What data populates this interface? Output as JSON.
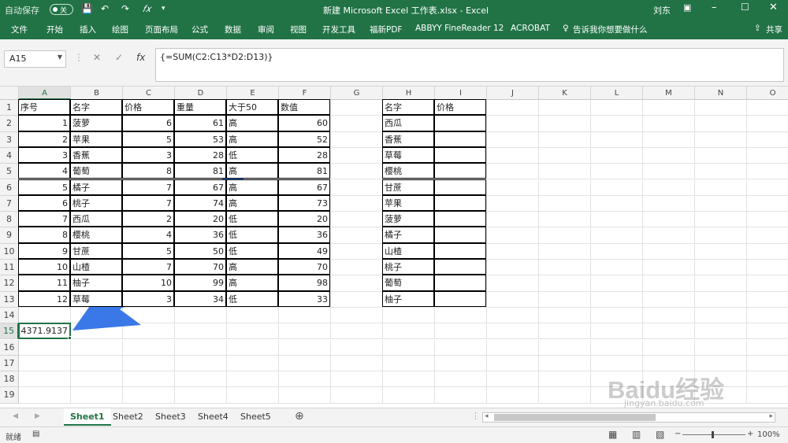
{
  "titlebar": {
    "autosave_label": "自动保存",
    "autosave_state": "关",
    "title": "新建 Microsoft Excel 工作表.xlsx  -  Excel",
    "user": "刘东"
  },
  "ribbon": {
    "tabs": [
      "文件",
      "开始",
      "插入",
      "绘图",
      "页面布局",
      "公式",
      "数据",
      "审阅",
      "视图",
      "开发工具",
      "福新PDF",
      "ABBYY FineReader 12",
      "ACROBAT"
    ],
    "tell_me": "告诉我你想要做什么",
    "share": "共享"
  },
  "formula_bar": {
    "name_box": "A15",
    "formula": "{=SUM(C2:C13*D2:D13)}"
  },
  "columns": [
    "A",
    "B",
    "C",
    "D",
    "E",
    "F",
    "G",
    "H",
    "I",
    "J",
    "K",
    "L",
    "M",
    "N",
    "O"
  ],
  "rows": [
    "1",
    "2",
    "3",
    "4",
    "5",
    "6",
    "7",
    "8",
    "9",
    "10",
    "11",
    "12",
    "13",
    "14",
    "15",
    "16",
    "17",
    "18",
    "19"
  ],
  "table1": {
    "headers": [
      "序号",
      "名字",
      "价格",
      "重量",
      "大于50",
      "数值"
    ],
    "rows": [
      [
        "1",
        "菠萝",
        "6",
        "61",
        "高",
        "60"
      ],
      [
        "2",
        "苹果",
        "5",
        "53",
        "高",
        "52"
      ],
      [
        "3",
        "香蕉",
        "3",
        "28",
        "低",
        "28"
      ],
      [
        "4",
        "葡萄",
        "8",
        "81",
        "高",
        "81"
      ],
      [
        "5",
        "橘子",
        "7",
        "67",
        "高",
        "67"
      ],
      [
        "6",
        "桃子",
        "7",
        "74",
        "高",
        "73"
      ],
      [
        "7",
        "西瓜",
        "2",
        "20",
        "低",
        "20"
      ],
      [
        "8",
        "樱桃",
        "4",
        "36",
        "低",
        "36"
      ],
      [
        "9",
        "甘蔗",
        "5",
        "50",
        "低",
        "49"
      ],
      [
        "10",
        "山楂",
        "7",
        "70",
        "高",
        "70"
      ],
      [
        "11",
        "柚子",
        "10",
        "99",
        "高",
        "98"
      ],
      [
        "12",
        "草莓",
        "3",
        "34",
        "低",
        "33"
      ]
    ]
  },
  "table2": {
    "headers": [
      "名字",
      "价格"
    ],
    "rows": [
      "西瓜",
      "香蕉",
      "草莓",
      "樱桃",
      "甘蔗",
      "苹果",
      "菠萝",
      "橘子",
      "山楂",
      "桃子",
      "葡萄",
      "柚子"
    ]
  },
  "result_cell": "4371.9137",
  "sheets": [
    "Sheet1",
    "Sheet2",
    "Sheet3",
    "Sheet4",
    "Sheet5"
  ],
  "status": {
    "ready": "就绪",
    "zoom": "100%"
  },
  "watermark": {
    "text": "Baidu经验",
    "url": "jingyan.baidu.com"
  },
  "colors": {
    "excel_green": "#217346",
    "annotation_arrow": "#3a78e8"
  }
}
